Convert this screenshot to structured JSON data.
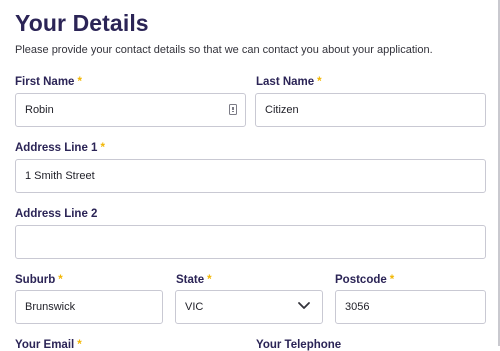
{
  "page": {
    "title": "Your Details",
    "subtitle": "Please provide your contact details so that we can contact you about your application."
  },
  "required_marker": "*",
  "colors": {
    "heading": "#2b2456",
    "required": "#f2b705",
    "border": "#c9c9d3"
  },
  "form": {
    "first_name": {
      "label": "First Name",
      "value": "Robin",
      "icon": "autofill-contact-icon"
    },
    "last_name": {
      "label": "Last Name",
      "value": "Citizen"
    },
    "address_line_1": {
      "label": "Address Line 1",
      "value": "1 Smith Street"
    },
    "address_line_2": {
      "label": "Address Line 2",
      "value": ""
    },
    "suburb": {
      "label": "Suburb",
      "value": "Brunswick"
    },
    "state": {
      "label": "State",
      "value": "VIC",
      "icon": "chevron-down-icon"
    },
    "postcode": {
      "label": "Postcode",
      "value": "3056"
    },
    "email": {
      "label": "Your Email"
    },
    "telephone": {
      "label": "Your Telephone"
    }
  }
}
